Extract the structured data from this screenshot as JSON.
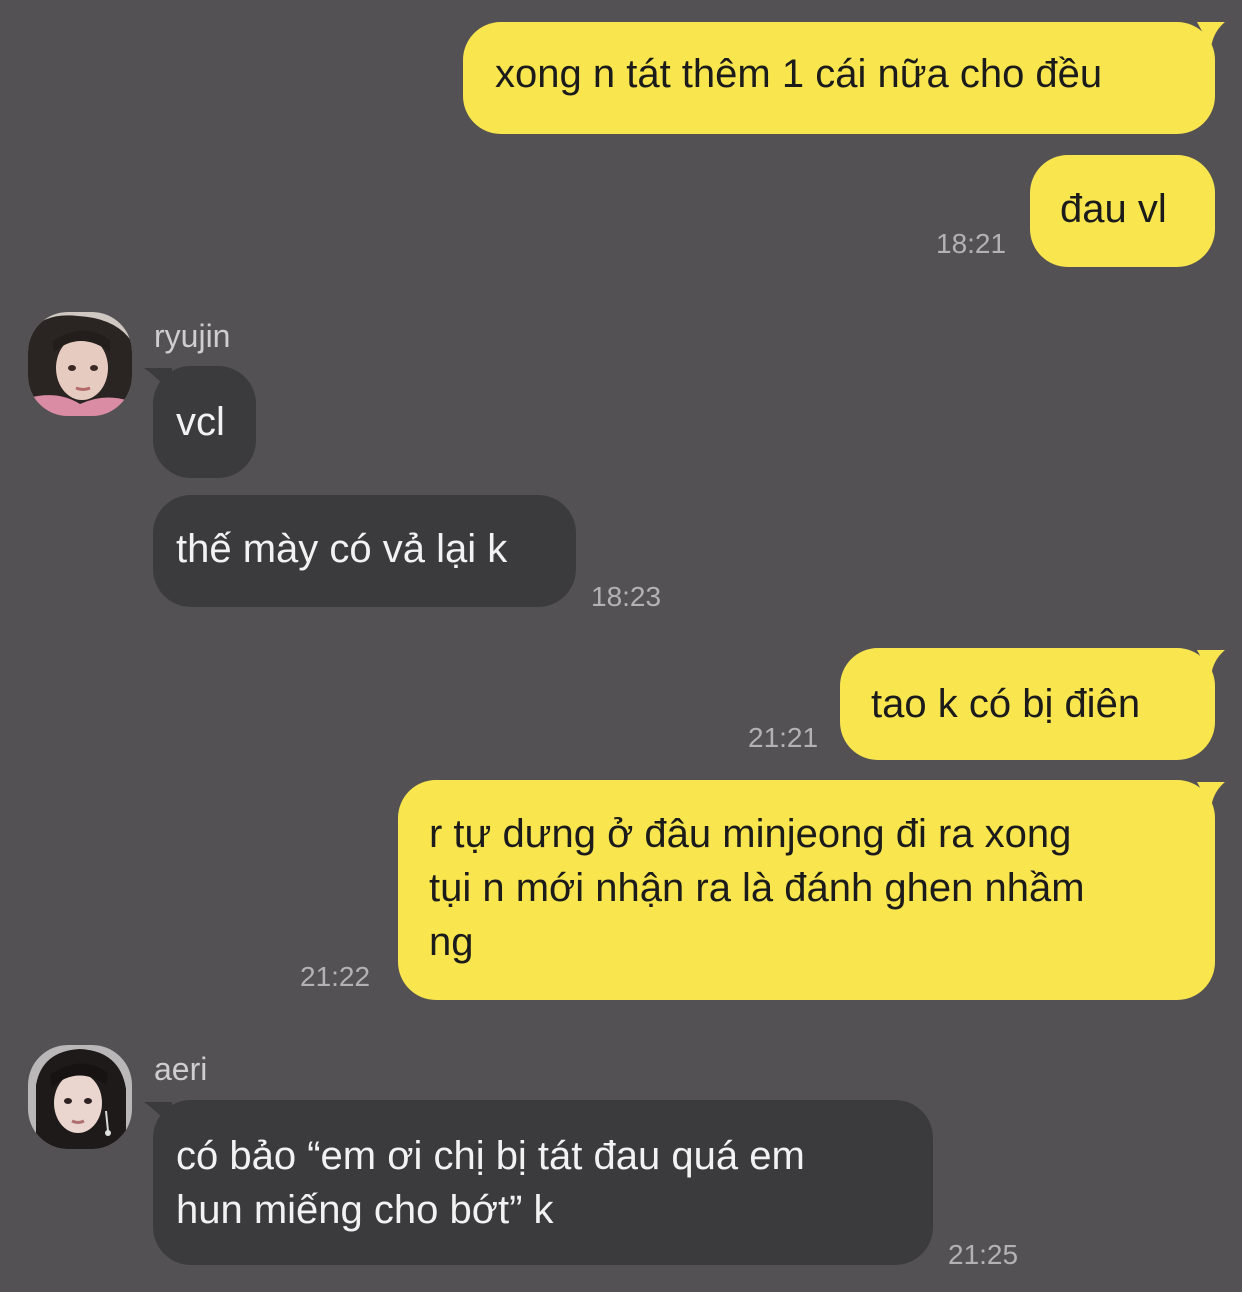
{
  "messages": {
    "m1": {
      "text": "xong n tát thêm 1 cái nữa cho đều"
    },
    "m2": {
      "text": "đau vl",
      "time": "18:21"
    },
    "ryujin": {
      "name": "ryujin",
      "m3": {
        "text": "vcl"
      },
      "m4": {
        "text": "thế mày có vả lại k",
        "time": "18:23"
      }
    },
    "m5": {
      "text": "tao k có bị điên",
      "time": "21:21"
    },
    "m6": {
      "line1": "r tự dưng ở đâu minjeong đi ra xong",
      "line2": "tụi n mới nhận ra là đánh ghen nhầm",
      "line3": "ng",
      "time": "21:22"
    },
    "aeri": {
      "name": "aeri",
      "m7": {
        "line1": "có bảo “em ơi chị bị tát đau quá em",
        "line2": "hun miếng cho bớt” k",
        "time": "21:25"
      }
    }
  },
  "colors": {
    "background": "#535153",
    "outgoing_bubble": "#F9E64E",
    "incoming_bubble": "#3B3A3D",
    "timestamp": "#B3B1B3",
    "sender_name": "#CFCDCF"
  },
  "icons": {
    "ryujin_avatar": "avatar-photo",
    "aeri_avatar": "avatar-photo"
  }
}
